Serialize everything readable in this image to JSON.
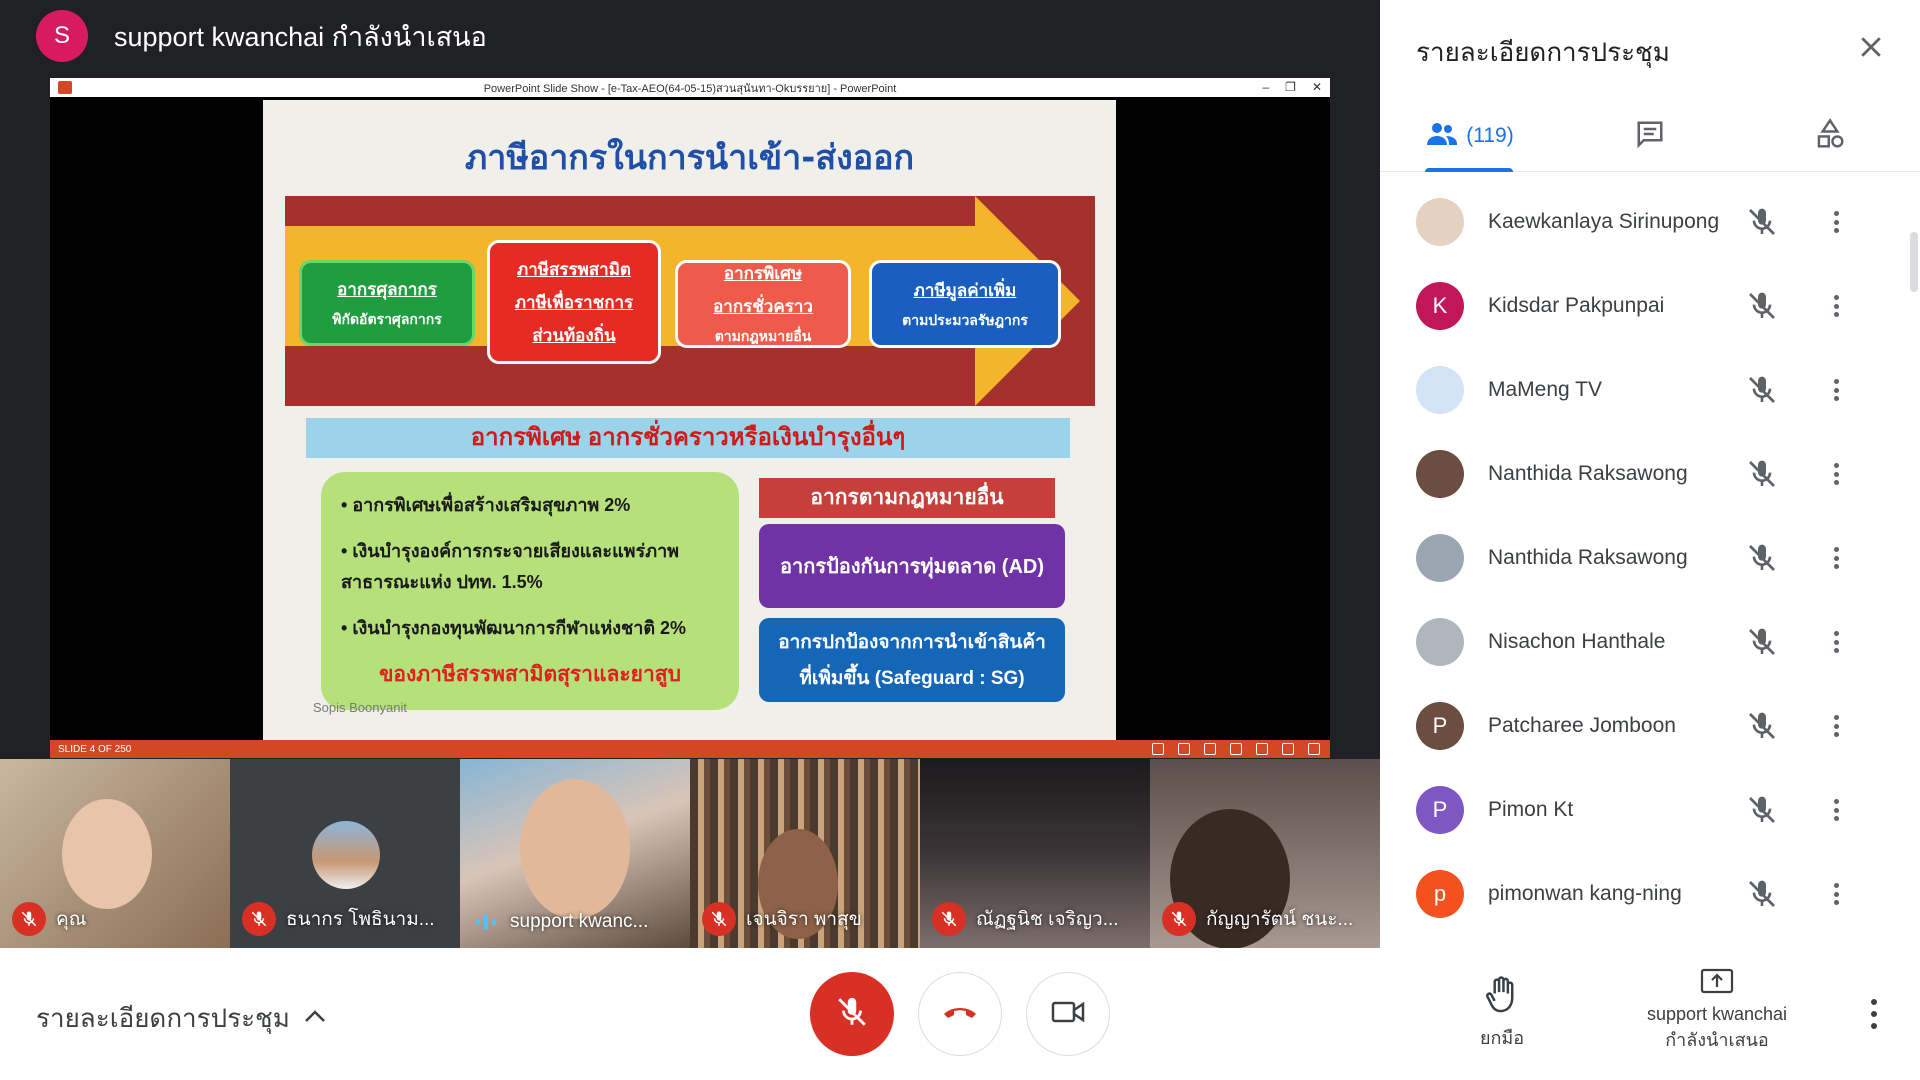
{
  "presenter": {
    "initial": "S",
    "title": "support kwanchai กำลังนำเสนอ",
    "avatar_color": "#d81b60"
  },
  "ppt": {
    "window_title": "PowerPoint Slide Show - [e-Tax-AEO(64-05-15)สวนสุนันทา-Okบรรยาย] - PowerPoint",
    "slide_counter": "SLIDE 4 OF 250"
  },
  "slide": {
    "title": "ภาษีอากรในการนำเข้า-ส่งออก",
    "box1": {
      "line1": "อากรศุลกากร",
      "line2": "พิกัดอัตราศุลกากร"
    },
    "box2": {
      "line1": "ภาษีสรรพสามิต",
      "line2": "ภาษีเพื่อราชการ",
      "line3": "ส่วนท้องถิ่น"
    },
    "box3": {
      "line1": "อากรพิเศษ",
      "line2": "อากรชั่วคราว",
      "line3": "ตามกฎหมายอื่น"
    },
    "box4": {
      "line1": "ภาษีมูลค่าเพิ่ม",
      "line2": "ตามประมวลรัษฎากร"
    },
    "section_header": "อากรพิเศษ อากรชั่วคราวหรือเงินบำรุงอื่นๆ",
    "bullets": [
      "อากรพิเศษเพื่อสร้างเสริมสุขภาพ 2%",
      "เงินบำรุงองค์การกระจายเสียงและแพร่ภาพสาธารณะแห่ง ปทท. 1.5%",
      "เงินบำรุงกองทุนพัฒนาการกีฬาแห่งชาติ 2%"
    ],
    "bullet_footer": "ของภาษีสรรพสามิตสุราและยาสูบ",
    "right_header": "อากรตามกฎหมายอื่น",
    "ad_box": "อากรป้องกันการทุ่มตลาด (AD)",
    "sg_box": {
      "line1": "อากรปกป้องจากการนำเข้าสินค้า",
      "line2": "ที่เพิ่มขึ้น (Safeguard : SG)"
    },
    "author": "Sopis Boonyanit"
  },
  "thumbnails": [
    {
      "name": "คุณ",
      "muted": true
    },
    {
      "name": "ธนากร โพธินาม...",
      "muted": true
    },
    {
      "name": "support kwanc...",
      "muted": false
    },
    {
      "name": "เจนจิรา พาสุข",
      "muted": true
    },
    {
      "name": "ณัฏฐนิช เจริญว...",
      "muted": true
    },
    {
      "name": "กัญญารัตน์ ชนะ...",
      "muted": true
    }
  ],
  "bottom_bar": {
    "details_label": "รายละเอียดการประชุม",
    "raise_hand_label": "ยกมือ",
    "present_label_1": "support kwanchai",
    "present_label_2": "กำลังนำเสนอ"
  },
  "side_panel": {
    "title": "รายละเอียดการประชุม",
    "people_count": "(119)",
    "participants": [
      {
        "name": "Kaewkanlaya Sirinupong",
        "initial": "",
        "color": "#e6d2c0"
      },
      {
        "name": "Kidsdar Pakpunpai",
        "initial": "K",
        "color": "#c2185b"
      },
      {
        "name": "MaMeng TV",
        "initial": "",
        "color": "#d4e4f7"
      },
      {
        "name": "Nanthida Raksawong",
        "initial": "",
        "color": "#6d4c41"
      },
      {
        "name": "Nanthida Raksawong",
        "initial": "",
        "color": "#9aa7b3"
      },
      {
        "name": "Nisachon Hanthale",
        "initial": "",
        "color": "#b0b6bd"
      },
      {
        "name": "Patcharee Jomboon",
        "initial": "P",
        "color": "#6d4c41"
      },
      {
        "name": "Pimon Kt",
        "initial": "P",
        "color": "#7e57c2"
      },
      {
        "name": "pimonwan kang-ning",
        "initial": "p",
        "color": "#f4511e"
      }
    ]
  },
  "colors": {
    "accent": "#1a73e8",
    "danger": "#d93025",
    "ppt_orange": "#d24726"
  }
}
